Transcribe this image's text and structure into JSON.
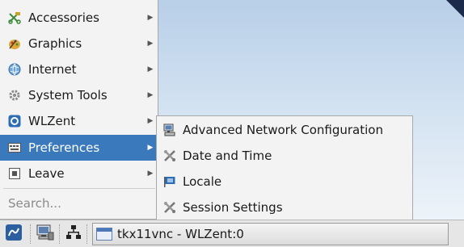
{
  "main_menu": {
    "items": [
      {
        "label": "Accessories",
        "icon": "accessories-icon",
        "submenu": true
      },
      {
        "label": "Graphics",
        "icon": "graphics-icon",
        "submenu": true
      },
      {
        "label": "Internet",
        "icon": "internet-icon",
        "submenu": true
      },
      {
        "label": "System Tools",
        "icon": "system-tools-icon",
        "submenu": true
      },
      {
        "label": "WLZent",
        "icon": "wlzent-icon",
        "submenu": true
      },
      {
        "label": "Preferences",
        "icon": "preferences-icon",
        "submenu": true,
        "active": true
      },
      {
        "label": "Leave",
        "icon": "leave-icon",
        "submenu": true
      }
    ],
    "search_placeholder": "Search..."
  },
  "preferences_submenu": {
    "items": [
      {
        "label": "Advanced Network Configuration",
        "icon": "network-config-icon"
      },
      {
        "label": "Date and Time",
        "icon": "date-time-icon"
      },
      {
        "label": "Locale",
        "icon": "locale-icon"
      },
      {
        "label": "Session Settings",
        "icon": "session-settings-icon"
      }
    ]
  },
  "taskbar": {
    "task_label": "tkx11vnc - WLZent:0"
  },
  "colors": {
    "highlight": "#3b79bd",
    "menu_bg": "#f3f3f3",
    "taskbar_bg": "#e6e6e6"
  }
}
